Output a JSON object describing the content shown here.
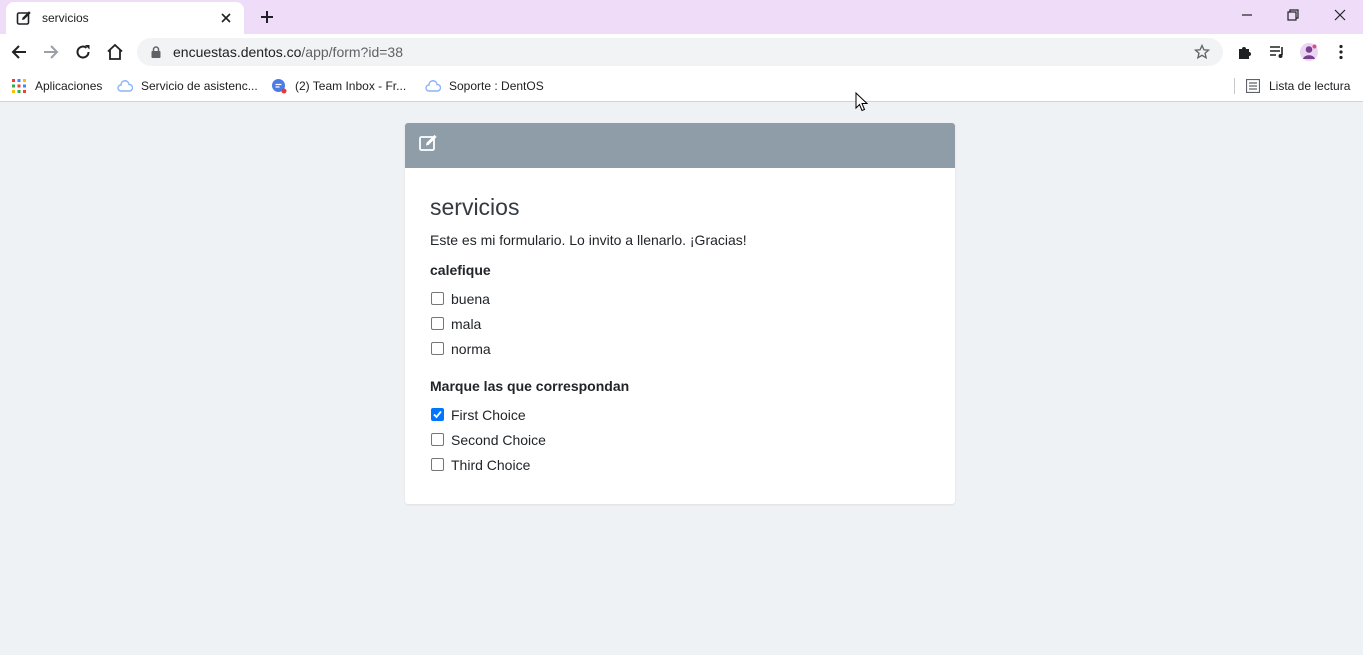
{
  "browser": {
    "tab": {
      "title": "servicios"
    },
    "address": {
      "host": "encuestas.dentos.co",
      "path": "/app/form?id=38"
    },
    "bookmarks": [
      {
        "label": "Aplicaciones",
        "icon": "apps-grid-icon"
      },
      {
        "label": "Servicio de asistenc...",
        "icon": "cloud-icon"
      },
      {
        "label": "(2) Team Inbox - Fr...",
        "icon": "chat-icon"
      },
      {
        "label": "Soporte : DentOS",
        "icon": "cloud-icon"
      }
    ],
    "reading_list": "Lista de lectura"
  },
  "form": {
    "title": "servicios",
    "description": "Este es mi formulario. Lo invito a llenarlo. ¡Gracias!",
    "groups": [
      {
        "label": "calefique",
        "options": [
          {
            "label": "buena",
            "checked": false
          },
          {
            "label": "mala",
            "checked": false
          },
          {
            "label": "norma",
            "checked": false
          }
        ]
      },
      {
        "label": "Marque las que correspondan",
        "options": [
          {
            "label": "First Choice",
            "checked": true
          },
          {
            "label": "Second Choice",
            "checked": false
          },
          {
            "label": "Third Choice",
            "checked": false
          }
        ]
      }
    ]
  },
  "colors": {
    "tabstrip": "#eedcf8",
    "page_bg": "#eff2f5",
    "card_header": "#8f9da9",
    "checkbox_checked": "#0075ff"
  }
}
